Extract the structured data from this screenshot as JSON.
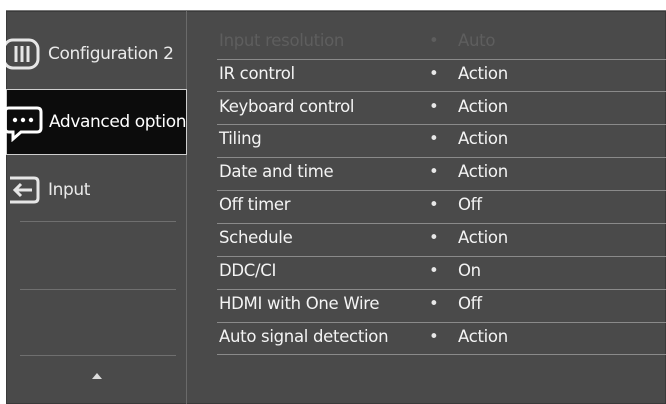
{
  "sidebar": {
    "items": [
      {
        "label": "Configuration 2",
        "icon": "configuration-icon"
      },
      {
        "label": "Advanced option",
        "icon": "advanced-option-icon",
        "active": true
      },
      {
        "label": "Input",
        "icon": "input-icon"
      }
    ],
    "scroll_up_icon": "up-arrow-icon"
  },
  "menu": {
    "rows": [
      {
        "name": "Input resolution",
        "value": "Auto",
        "disabled": true
      },
      {
        "name": "IR control",
        "value": "Action"
      },
      {
        "name": "Keyboard control",
        "value": "Action"
      },
      {
        "name": "Tiling",
        "value": "Action"
      },
      {
        "name": "Date and time",
        "value": "Action"
      },
      {
        "name": "Off timer",
        "value": "Off"
      },
      {
        "name": "Schedule",
        "value": "Action"
      },
      {
        "name": "DDC/CI",
        "value": "On"
      },
      {
        "name": "HDMI with One Wire",
        "value": "Off"
      },
      {
        "name": "Auto signal detection",
        "value": "Action"
      }
    ],
    "bullet": "•"
  },
  "colors": {
    "panel": "#4a4a4a",
    "active_bg": "#0c0c0c",
    "text": "#f4f4f4",
    "dim_text": "#5e5e5e"
  }
}
